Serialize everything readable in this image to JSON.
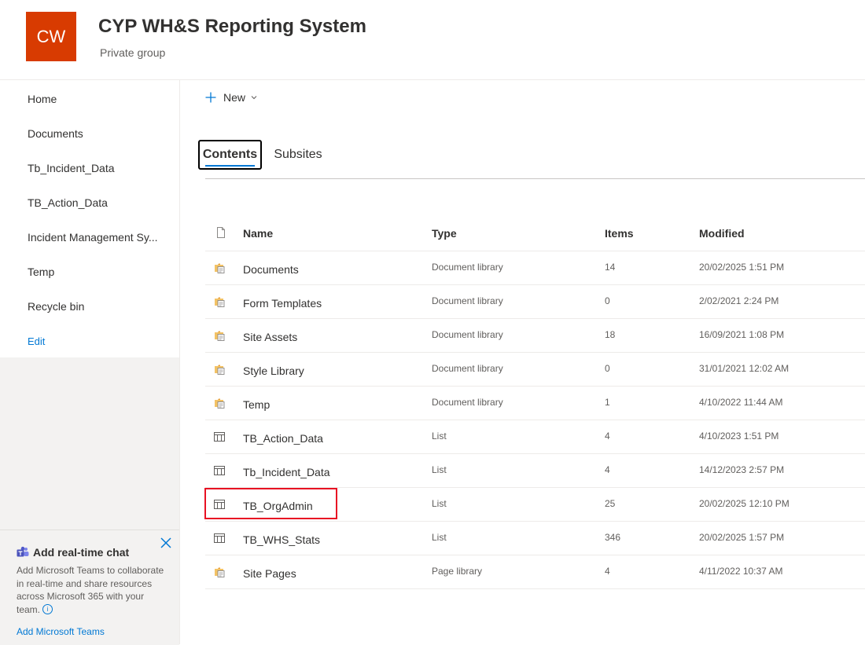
{
  "site": {
    "logo_text": "CW",
    "title": "CYP WH&S Reporting System",
    "subtitle": "Private group",
    "logo_color": "#d83b01"
  },
  "nav": {
    "items": [
      {
        "label": "Home"
      },
      {
        "label": "Documents"
      },
      {
        "label": "Tb_Incident_Data"
      },
      {
        "label": "TB_Action_Data"
      },
      {
        "label": "Incident Management Sy..."
      },
      {
        "label": "Temp"
      },
      {
        "label": "Recycle bin"
      }
    ],
    "edit_label": "Edit"
  },
  "chat_card": {
    "title": "Add real-time chat",
    "body": "Add Microsoft Teams to collaborate in real-time and share resources across Microsoft 365 with your team.",
    "link": "Add Microsoft Teams",
    "info_glyph": "i"
  },
  "toolbar": {
    "new_label": "New"
  },
  "tabs": [
    {
      "label": "Contents",
      "active": true
    },
    {
      "label": "Subsites",
      "active": false
    }
  ],
  "table": {
    "headers": {
      "name": "Name",
      "type": "Type",
      "items": "Items",
      "modified": "Modified"
    },
    "rows": [
      {
        "icon": "library-icon",
        "name": "Documents",
        "type": "Document library",
        "items": "14",
        "modified": "20/02/2025 1:51 PM"
      },
      {
        "icon": "library-icon",
        "name": "Form Templates",
        "type": "Document library",
        "items": "0",
        "modified": "2/02/2021 2:24 PM"
      },
      {
        "icon": "library-icon",
        "name": "Site Assets",
        "type": "Document library",
        "items": "18",
        "modified": "16/09/2021 1:08 PM"
      },
      {
        "icon": "library-icon",
        "name": "Style Library",
        "type": "Document library",
        "items": "0",
        "modified": "31/01/2021 12:02 AM"
      },
      {
        "icon": "library-icon",
        "name": "Temp",
        "type": "Document library",
        "items": "1",
        "modified": "4/10/2022 11:44 AM"
      },
      {
        "icon": "list-icon",
        "name": "TB_Action_Data",
        "type": "List",
        "items": "4",
        "modified": "4/10/2023 1:51 PM"
      },
      {
        "icon": "list-icon",
        "name": "Tb_Incident_Data",
        "type": "List",
        "items": "4",
        "modified": "14/12/2023 2:57 PM"
      },
      {
        "icon": "list-icon",
        "name": "TB_OrgAdmin",
        "type": "List",
        "items": "25",
        "modified": "20/02/2025 12:10 PM"
      },
      {
        "icon": "list-icon",
        "name": "TB_WHS_Stats",
        "type": "List",
        "items": "346",
        "modified": "20/02/2025 1:57 PM"
      },
      {
        "icon": "library-icon",
        "name": "Site Pages",
        "type": "Page library",
        "items": "4",
        "modified": "4/11/2022 10:37 AM"
      }
    ]
  },
  "colors": {
    "accent": "#0078d4",
    "highlight": "#e81123"
  }
}
